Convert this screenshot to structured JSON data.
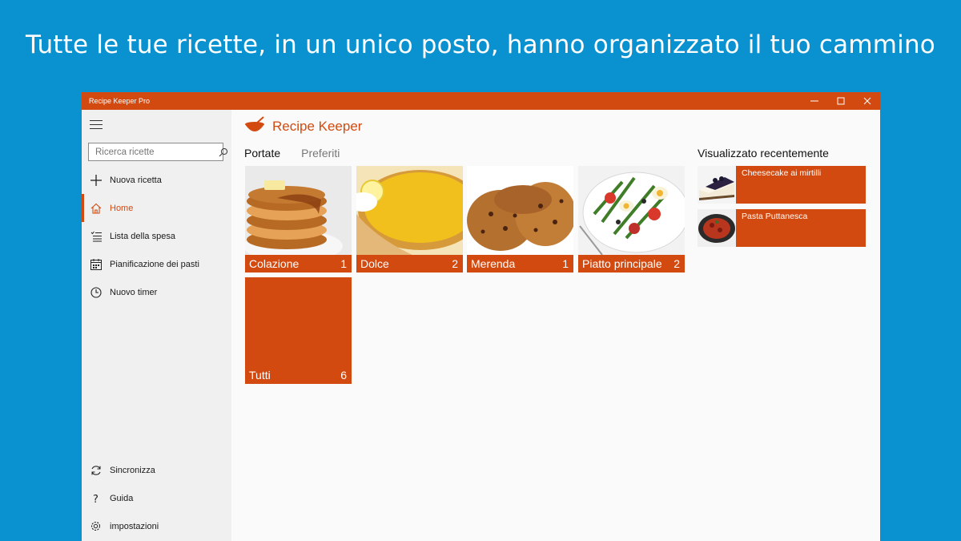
{
  "headline": "Tutte le tue ricette, in un unico posto, hanno organizzato il tuo cammino",
  "window": {
    "title": "Recipe Keeper Pro",
    "controls": [
      "minimize-icon",
      "maximize-icon",
      "close-icon"
    ]
  },
  "colors": {
    "accent": "#d34a10",
    "background": "#0a91d0",
    "sidebar": "#f0f0f0"
  },
  "sidebar": {
    "search_placeholder": "Ricerca ricette",
    "items": [
      {
        "label": "Nuova ricetta",
        "icon": "plus-icon"
      },
      {
        "label": "Home",
        "icon": "home-icon",
        "active": true
      },
      {
        "label": "Lista della spesa",
        "icon": "checklist-icon"
      },
      {
        "label": "Pianificazione dei pasti",
        "icon": "calendar-icon"
      },
      {
        "label": "Nuovo timer",
        "icon": "clock-icon"
      }
    ],
    "bottom_items": [
      {
        "label": "Sincronizza",
        "icon": "sync-icon"
      },
      {
        "label": "Guida",
        "icon": "help-icon"
      },
      {
        "label": "impostazioni",
        "icon": "gear-icon"
      }
    ]
  },
  "app": {
    "name": "Recipe Keeper",
    "tabs": [
      {
        "label": "Portate",
        "active": true
      },
      {
        "label": "Preferiti",
        "active": false
      }
    ]
  },
  "tiles": [
    {
      "label": "Colazione",
      "count": "1",
      "image": "pancakes"
    },
    {
      "label": "Dolce",
      "count": "2",
      "image": "lemon-tart"
    },
    {
      "label": "Merenda",
      "count": "1",
      "image": "cookies"
    },
    {
      "label": "Piatto principale",
      "count": "2",
      "image": "salad"
    },
    {
      "label": "Tutti",
      "count": "6",
      "image": ""
    }
  ],
  "recent": {
    "title": "Visualizzato recentemente",
    "items": [
      {
        "label": "Cheesecake ai mirtilli",
        "image": "cheesecake"
      },
      {
        "label": "Pasta Puttanesca",
        "image": "pasta"
      }
    ]
  }
}
